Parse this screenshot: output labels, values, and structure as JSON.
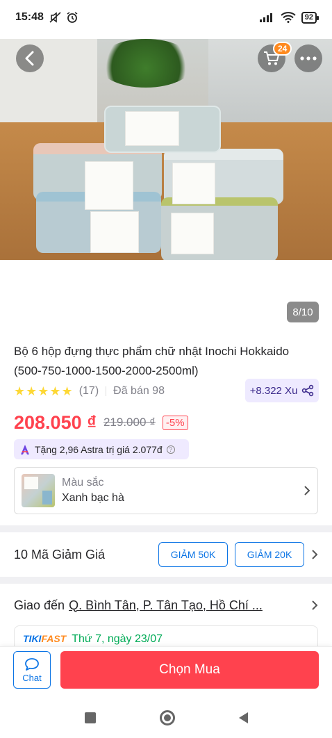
{
  "status_bar": {
    "time": "15:48",
    "battery": "92",
    "icons": [
      "mute-icon",
      "alarm-icon",
      "signal-icon",
      "wifi-icon",
      "battery-icon"
    ]
  },
  "header": {
    "cart_count": "24",
    "icons": [
      "back-arrow-icon",
      "cart-icon",
      "more-icon"
    ]
  },
  "gallery": {
    "counter": "8/10"
  },
  "product": {
    "title": "Bộ 6 hộp đựng thực phẩm chữ nhật Inochi Hokkaido (500-750-1000-1500-2000-2500ml)",
    "stars": "★★★★★",
    "review_count": "(17)",
    "sold": "Đã bán 98",
    "xu": "+8.322 Xu",
    "price": "208.050 ₫",
    "old_price": "219.000 ₫",
    "discount": "-5%",
    "astra": "Tặng 2,96 Astra trị giá 2.077đ",
    "colors": {
      "accent": "#ff424e",
      "star": "#fdd836",
      "link": "#0b74e5"
    }
  },
  "variant": {
    "label": "Màu sắc",
    "value": "Xanh bạc hà"
  },
  "coupons": {
    "title": "10 Mã Giảm Giá",
    "items": [
      "GIẢM 50K",
      "GIẢM 20K"
    ]
  },
  "delivery": {
    "prefix": "Giao đến",
    "address": "Q. Bình Tân, P. Tân Tạo, Hồ Chí ...",
    "tikifast_logo_a": "TIKI",
    "tikifast_logo_b": "FAST",
    "date": "Thứ 7, ngày 23/07"
  },
  "bottom_bar": {
    "chat": "Chat",
    "buy": "Chọn Mua"
  }
}
